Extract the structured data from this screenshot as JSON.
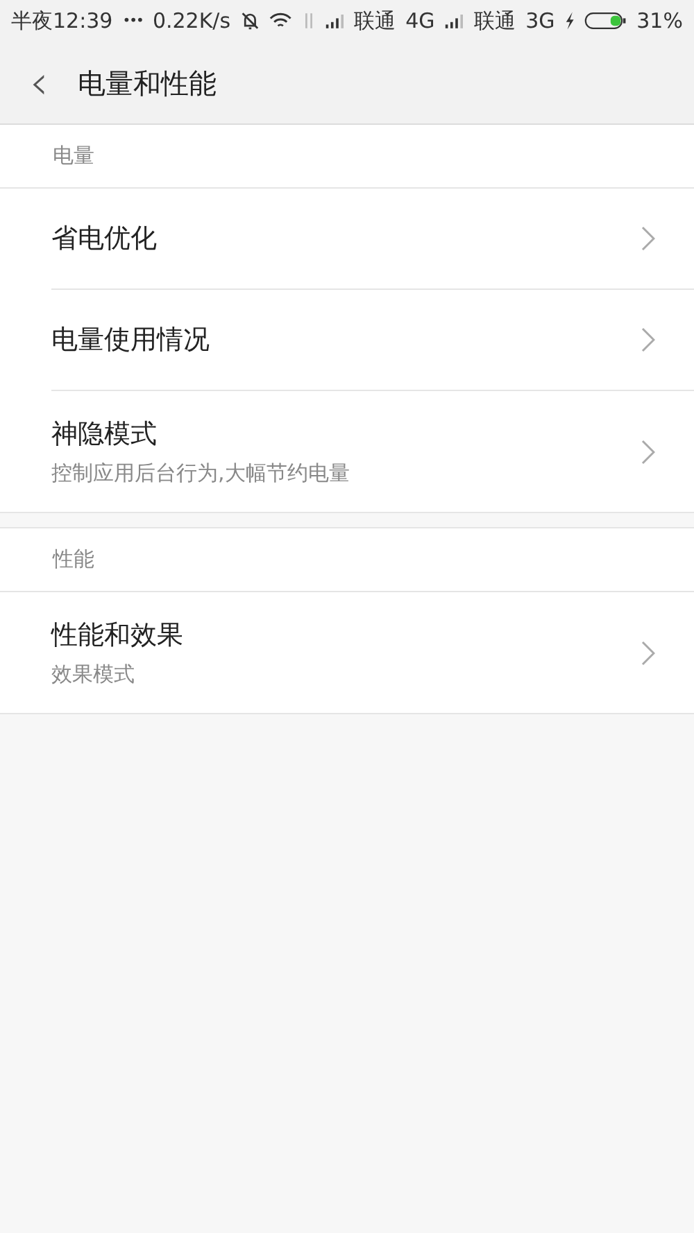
{
  "status_bar": {
    "time": "半夜12:39",
    "dots": "•••",
    "speed": "0.22K/s",
    "carrier_1": "联通",
    "network_1": "4G",
    "carrier_2": "联通",
    "network_2": "3G",
    "battery": "31%"
  },
  "header": {
    "back": "‹",
    "title": "电量和性能"
  },
  "sections": [
    {
      "title": "电量",
      "items": [
        {
          "label": "省电优化"
        },
        {
          "label": "电量使用情况"
        },
        {
          "label": "神隐模式",
          "subtitle": "控制应用后台行为,大幅节约电量"
        }
      ]
    },
    {
      "title": "性能",
      "items": [
        {
          "label": "性能和效果",
          "subtitle": "效果模式"
        }
      ]
    }
  ]
}
